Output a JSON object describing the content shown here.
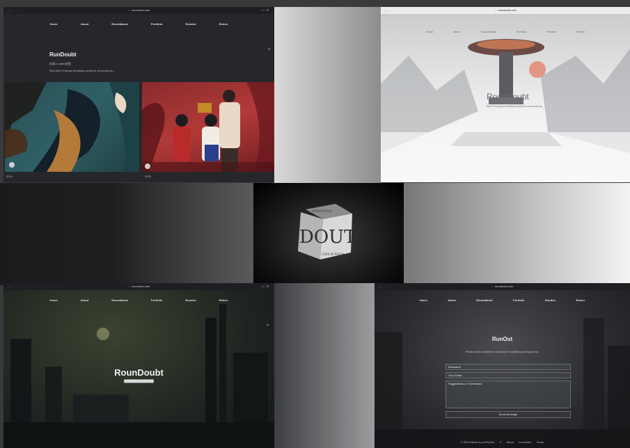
{
  "browser": {
    "address": "← roundoubt.com",
    "controls": "□ ← →",
    "tabs": "⊕ + ⧉"
  },
  "nav": [
    "Home",
    "About",
    "Roundabout",
    "Portfolio",
    "Rundun",
    "Return"
  ],
  "window1": {
    "title": "RunDoubt",
    "badge": "红球 | Lorem对我",
    "description": "Roll with it through blowBack-world by all wondrous...",
    "captions": [
      "2024",
      "2023"
    ]
  },
  "window2": {
    "title": "RounDoubt",
    "subtitle": "Roll it through blowBack-world in a wondrous"
  },
  "cube": {
    "letters": "DOUT",
    "top": "SMOOTH PASS",
    "bottom": "CORE IN TOUCH"
  },
  "window3": {
    "title": "RounDoubt",
    "subtitle": "███████████████"
  },
  "window4": {
    "title": "RunOut",
    "hint": "Please enter contents in text area. If anything wrong just so.",
    "name_placeholder": "Nickname",
    "email_placeholder": "Your Email",
    "message_placeholder": "Suggestions or Corrections",
    "send_label": "Send Message",
    "footer": [
      "© 2024 Made by sunFlyTen",
      "X",
      "About",
      "Correction",
      "Home"
    ]
  },
  "colors": {
    "dark_bg": "#25272b",
    "accent_red": "#b13a38",
    "teal": "#2f6066"
  }
}
